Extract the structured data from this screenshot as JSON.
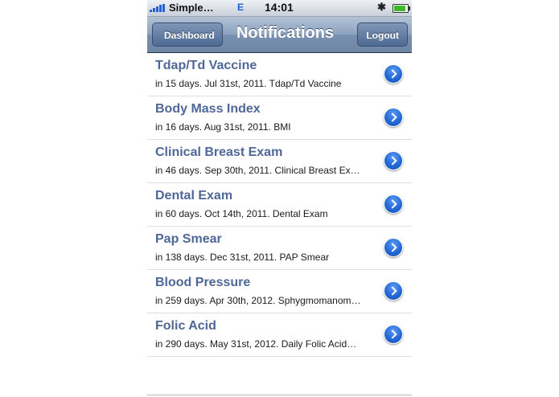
{
  "status_bar": {
    "carrier": "Simple…",
    "network": "E",
    "time": "14:01",
    "signal_icon": "signal-bars-icon",
    "bluetooth_icon": "bluetooth-icon",
    "battery_icon": "battery-icon",
    "battery_level": 0.85
  },
  "nav_bar": {
    "back_label": "Dashboard",
    "title": "Notifications",
    "logout_label": "Logout"
  },
  "notifications": [
    {
      "title": "Tdap/Td Vaccine",
      "detail": "in 15 days. Jul 31st, 2011. Tdap/Td Vaccine"
    },
    {
      "title": "Body Mass Index",
      "detail": "in 16 days. Aug 31st, 2011. BMI"
    },
    {
      "title": "Clinical Breast Exam",
      "detail": "in 46 days. Sep 30th, 2011. Clinical Breast Ex…"
    },
    {
      "title": "Dental Exam",
      "detail": "in 60 days. Oct 14th, 2011. Dental  Exam"
    },
    {
      "title": "Pap Smear",
      "detail": "in 138 days. Dec 31st, 2011. PAP Smear"
    },
    {
      "title": "Blood Pressure",
      "detail": "in 259 days. Apr 30th, 2012. Sphygmomanom…"
    },
    {
      "title": "Folic Acid",
      "detail": "in 290 days. May 31st, 2012. Daily Folic Acid…"
    }
  ],
  "colors": {
    "title_text": "#4f6796",
    "disclosure": "#2468d8",
    "nav_bar": "#8da2bf"
  }
}
